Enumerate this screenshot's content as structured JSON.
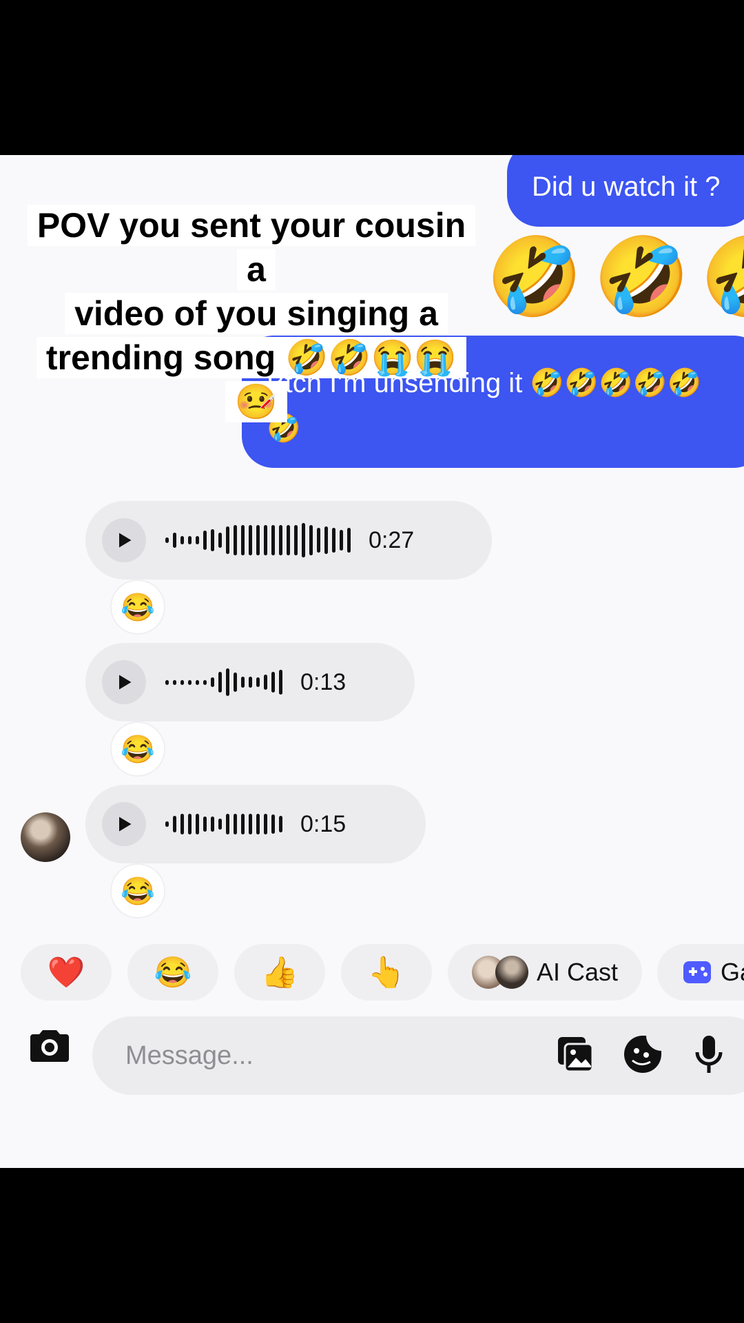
{
  "caption": {
    "line1": "POV you sent your cousin a",
    "line2": "video of you singing a",
    "line3": "trending song 🤣🤣😭😭🤒"
  },
  "messages": {
    "out1": "Did u watch it ?",
    "big_emojis": "🤣🤣🤣",
    "out2_line1": "Btch I’m unsending it 🤣🤣🤣🤣🤣",
    "out2_line2": "🤣"
  },
  "voice_messages": [
    {
      "duration": "0:27",
      "reaction": "😂"
    },
    {
      "duration": "0:13",
      "reaction": "😂"
    },
    {
      "duration": "0:15",
      "reaction": "😂"
    }
  ],
  "quick_reactions": {
    "heart": "❤️",
    "laugh": "😂",
    "thumbs": "👍",
    "point": "👆",
    "ai_cast": "AI Cast",
    "games": "Ga"
  },
  "composer": {
    "placeholder": "Message..."
  },
  "colors": {
    "accent": "#3d55f1",
    "games_icon": "#4f5bff"
  },
  "icons": [
    "play-icon",
    "camera-icon",
    "gallery-icon",
    "sticker-icon",
    "microphone-icon",
    "gamepad-icon"
  ]
}
